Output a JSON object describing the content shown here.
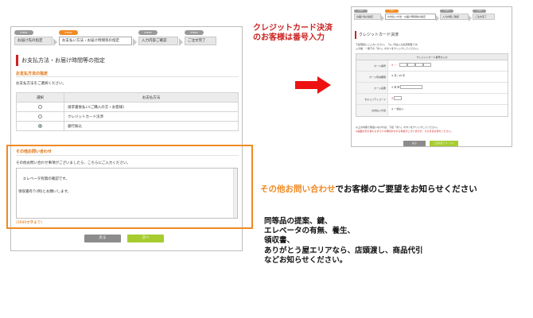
{
  "left_screen": {
    "steps": [
      {
        "tag": "STEP1",
        "label": "お届け先の指定"
      },
      {
        "tag": "STEP2",
        "label": "お支払い方法・お届け時間等の指定"
      },
      {
        "tag": "STEP3",
        "label": "入力内容ご確認"
      },
      {
        "tag": "STEP4",
        "label": "ご注文完了"
      }
    ],
    "page_title": "お支払方法・お届け時間等の指定",
    "payment_section_title": "お支払方法の指定",
    "payment_instruction": "お支払方法をご選択ください。",
    "table": {
      "headers": [
        "選択",
        "お支払方法"
      ],
      "rows": [
        {
          "label": "請求書後払い(ご購入の方・お客様)",
          "selected": false
        },
        {
          "label": "クレジットカード決済",
          "selected": false
        },
        {
          "label": "銀行振込",
          "selected": true
        }
      ]
    },
    "inquiry_section_title": "その他お問い合わせ",
    "inquiry_instruction": "その他お問い合わせ事項がございましたら、こちらにご入力ください。",
    "inquiry_value": "エレベータ有無の確認です。\n\n領収書有り(例)とお願いします。",
    "char_limit": "(3000文字まで)",
    "back_button": "戻る",
    "next_button": "次へ"
  },
  "right_screen": {
    "steps": [
      {
        "tag": "STEP1",
        "label": "お届け先の指定"
      },
      {
        "tag": "STEP2",
        "label": "お支払い方法・お届け時間等の指定"
      },
      {
        "tag": "STEP3",
        "label": "入力内容ご確認"
      },
      {
        "tag": "STEP4",
        "label": "ご注文完了"
      }
    ],
    "page_title": "クレジットカード決済",
    "intro_line1": "下記項目にご入力ください。「※」印は入力必須項目です。",
    "intro_line2": "入力後、一番下の「次へ」ボタンをクリックしてください。",
    "form_header": "クレジットカード番号の入力",
    "fields": [
      {
        "label": "カード番号",
        "value": "※ -  -  - "
      },
      {
        "label": "カード有効期限",
        "value": "※ 月 / 20 年"
      },
      {
        "label": "カード名義",
        "value": "※ 名  姓"
      },
      {
        "label": "セキュリティコード",
        "value": "※"
      },
      {
        "label": "お支払い方法",
        "value": "※ 一括払い"
      }
    ],
    "note_line1": "以上の内容で間違いなければ、下記「次へ」ボタンをクリックしてください。",
    "note_line2": "※画面が切り替わるまで少々時間がかかる場合がございますが、そのままお待ちください。",
    "back_button": "戻る",
    "next_button": "ご注文完了ページへ"
  },
  "callouts": {
    "red_line1": "クレジットカード決済",
    "red_line2": "のお客様は番号入力",
    "mid_orange": "その他お問い合わせ",
    "mid_rest": "でお客様のご要望をお知らせください",
    "notes": [
      "同等品の提案、鍵、",
      "エレベータの有無、養生、",
      "領収書、",
      "ありがとう屋エリアなら、店頭渡し、商品代引",
      "などお知らせください。"
    ]
  },
  "colors": {
    "accent_orange": "#f08a24",
    "accent_red": "#cc2222",
    "next_green": "#a6cc2f",
    "back_gray": "#8c8c8c"
  }
}
